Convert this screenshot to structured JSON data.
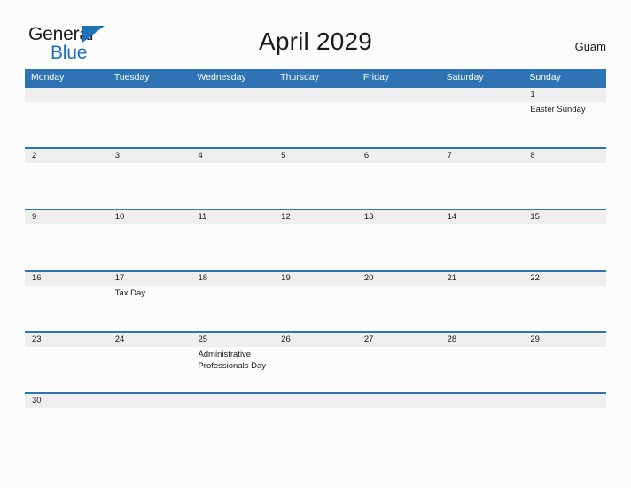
{
  "logo": {
    "word1": "General",
    "word2": "Blue",
    "triangle_icon": "triangle-icon",
    "color_dark": "#1b1b1b",
    "color_blue": "#1f72b8"
  },
  "header": {
    "title": "April 2029",
    "region": "Guam"
  },
  "colors": {
    "header_blue": "#2e74b5",
    "date_band_gray": "#efefef",
    "page_background": "#fcfcfc",
    "text": "#1a1a1a"
  },
  "calendar": {
    "day_headers": [
      "Monday",
      "Tuesday",
      "Wednesday",
      "Thursday",
      "Friday",
      "Saturday",
      "Sunday"
    ],
    "weeks": [
      {
        "days": [
          {
            "date": "",
            "events": []
          },
          {
            "date": "",
            "events": []
          },
          {
            "date": "",
            "events": []
          },
          {
            "date": "",
            "events": []
          },
          {
            "date": "",
            "events": []
          },
          {
            "date": "",
            "events": []
          },
          {
            "date": "1",
            "events": [
              "Easter Sunday"
            ]
          }
        ]
      },
      {
        "days": [
          {
            "date": "2",
            "events": []
          },
          {
            "date": "3",
            "events": []
          },
          {
            "date": "4",
            "events": []
          },
          {
            "date": "5",
            "events": []
          },
          {
            "date": "6",
            "events": []
          },
          {
            "date": "7",
            "events": []
          },
          {
            "date": "8",
            "events": []
          }
        ]
      },
      {
        "days": [
          {
            "date": "9",
            "events": []
          },
          {
            "date": "10",
            "events": []
          },
          {
            "date": "11",
            "events": []
          },
          {
            "date": "12",
            "events": []
          },
          {
            "date": "13",
            "events": []
          },
          {
            "date": "14",
            "events": []
          },
          {
            "date": "15",
            "events": []
          }
        ]
      },
      {
        "days": [
          {
            "date": "16",
            "events": []
          },
          {
            "date": "17",
            "events": [
              "Tax Day"
            ]
          },
          {
            "date": "18",
            "events": []
          },
          {
            "date": "19",
            "events": []
          },
          {
            "date": "20",
            "events": []
          },
          {
            "date": "21",
            "events": []
          },
          {
            "date": "22",
            "events": []
          }
        ]
      },
      {
        "days": [
          {
            "date": "23",
            "events": []
          },
          {
            "date": "24",
            "events": []
          },
          {
            "date": "25",
            "events": [
              "Administrative Professionals Day"
            ]
          },
          {
            "date": "26",
            "events": []
          },
          {
            "date": "27",
            "events": []
          },
          {
            "date": "28",
            "events": []
          },
          {
            "date": "29",
            "events": []
          }
        ]
      },
      {
        "days": [
          {
            "date": "30",
            "events": []
          },
          {
            "date": "",
            "events": []
          },
          {
            "date": "",
            "events": []
          },
          {
            "date": "",
            "events": []
          },
          {
            "date": "",
            "events": []
          },
          {
            "date": "",
            "events": []
          },
          {
            "date": "",
            "events": []
          }
        ]
      }
    ]
  }
}
